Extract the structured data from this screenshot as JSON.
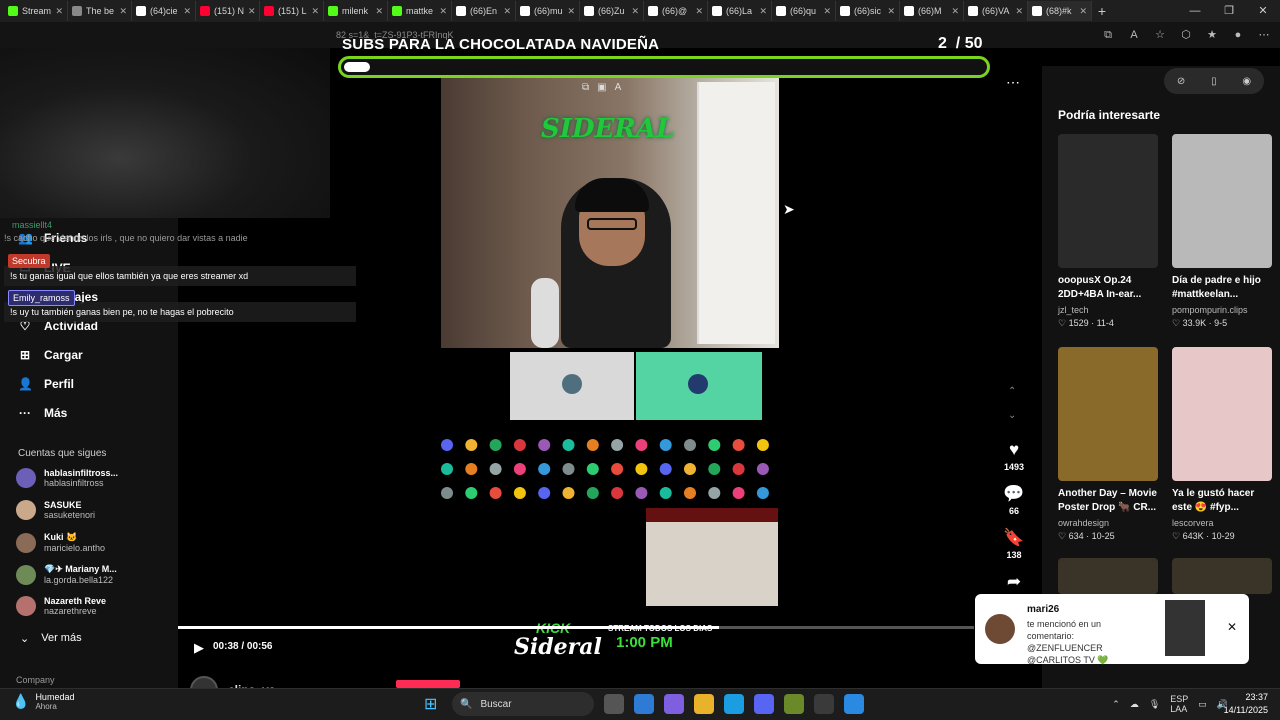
{
  "browser": {
    "tabs": [
      {
        "label": "Stream",
        "color": "#53fc18"
      },
      {
        "label": "The be",
        "color": "#888888"
      },
      {
        "label": "(64)cie",
        "color": "#ffffff"
      },
      {
        "label": "(151) N",
        "color": "#ff0033"
      },
      {
        "label": "(151) L",
        "color": "#ff0033"
      },
      {
        "label": "milenk",
        "color": "#53fc18"
      },
      {
        "label": "mattke",
        "color": "#53fc18"
      },
      {
        "label": "(66)En",
        "color": "#ffffff"
      },
      {
        "label": "(66)mu",
        "color": "#ffffff"
      },
      {
        "label": "(66)Zu",
        "color": "#ffffff"
      },
      {
        "label": "(66)@",
        "color": "#ffffff"
      },
      {
        "label": "(66)La",
        "color": "#ffffff"
      },
      {
        "label": "(66)qu",
        "color": "#ffffff"
      },
      {
        "label": "(66)sic",
        "color": "#ffffff"
      },
      {
        "label": "(66)M",
        "color": "#ffffff"
      },
      {
        "label": "(66)VA",
        "color": "#ffffff"
      },
      {
        "label": "(68)#k",
        "color": "#ffffff"
      }
    ],
    "url_fragment": "82 s=1&_t=ZS-91P3-tFRInqK"
  },
  "goal": {
    "title": "SUBS PARA LA CHOCOLATADA NAVIDEÑA",
    "current": "2",
    "total": "/ 50",
    "fraction": 0.04
  },
  "sidebar": {
    "nav": [
      {
        "icon": "👥",
        "label": "Friends"
      },
      {
        "icon": "▭",
        "label": "LIVE"
      },
      {
        "icon": "✉",
        "label": "Mensajes"
      },
      {
        "icon": "♡",
        "label": "Actividad"
      },
      {
        "icon": "⊞",
        "label": "Cargar"
      },
      {
        "icon": "👤",
        "label": "Perfil"
      },
      {
        "icon": "···",
        "label": "Más"
      }
    ],
    "following_title": "Cuentas que sigues",
    "following": [
      {
        "name": "hablasinfiltross...",
        "handle": "hablasinfiltross",
        "color": "#6b5fb8"
      },
      {
        "name": "SASUKE",
        "handle": "sasuketenori",
        "color": "#caa98a"
      },
      {
        "name": "Kuki 🐱",
        "handle": "maricielo.antho",
        "color": "#8a6b57"
      },
      {
        "name": "💎✈ Mariany M...",
        "handle": "la.gorda.bella122",
        "color": "#6e8a57"
      },
      {
        "name": "Nazareth Reve",
        "handle": "nazarethreve",
        "color": "#b5716e"
      }
    ],
    "see_more": "Ver más",
    "company": "Company"
  },
  "chat": {
    "faint_line": "!s cacho      que viendo los irls , que no quiero dar vistas a nadie",
    "lines": [
      "!s tu ganas igual que ellos también ya que eres streamer xd",
      "!s uy tu también ganas bien pe, no te hagas el pobrecito"
    ],
    "users": [
      {
        "name": "massiellt4",
        "color": "#3b9c6b"
      },
      {
        "name": "Secubra",
        "color": "#c0392b"
      },
      {
        "name": "Emily_ramoss",
        "color": "#2c2c6e"
      }
    ]
  },
  "video": {
    "logo": "SIDERAL",
    "banner_brand": "KICK",
    "banner_name": "Sideral",
    "banner_sched": "STREAM TODOS LOS DIAS",
    "banner_time": "1:00 PM",
    "time": "00:38 / 00:56",
    "progress": 0.68,
    "channel": "clips_ya"
  },
  "actions": {
    "likes": "1493",
    "comments": "66",
    "saves": "138"
  },
  "right_panel": {
    "title": "Podría interesarte",
    "cards": [
      {
        "caption": "ooopusX Op.24 2DD+4BA In-ear...",
        "author": "jzl_tech",
        "stats": "♡ 1529 · 11-4",
        "bg": "#2a2a2a"
      },
      {
        "caption": "Día de padre e hijo #mattkeelan...",
        "author": "pompompurin.clips",
        "stats": "♡ 33.9K · 9-5",
        "bg": "#b9b9b9"
      },
      {
        "caption": "Another Day – Movie Poster Drop 🐂 CR...",
        "author": "owrahdesign",
        "stats": "♡ 634 · 10-25",
        "bg": "#8a6a2a"
      },
      {
        "caption": "Ya le gustó hacer este 😍 #fyp...",
        "author": "lescorvera",
        "stats": "♡ 643K · 10-29",
        "bg": "#e8c7c9"
      }
    ]
  },
  "toast": {
    "user": "mari26",
    "message": "te mencionó en un comentario: @ZENFLUENCER @CARLITOS TV 💚"
  },
  "taskbar": {
    "weather_label": "Humedad",
    "weather_sub": "Ahora",
    "search": "Buscar",
    "lang": "ESP",
    "lang_sub": "LAA",
    "time": "23:37",
    "date": "14/11/2025"
  }
}
